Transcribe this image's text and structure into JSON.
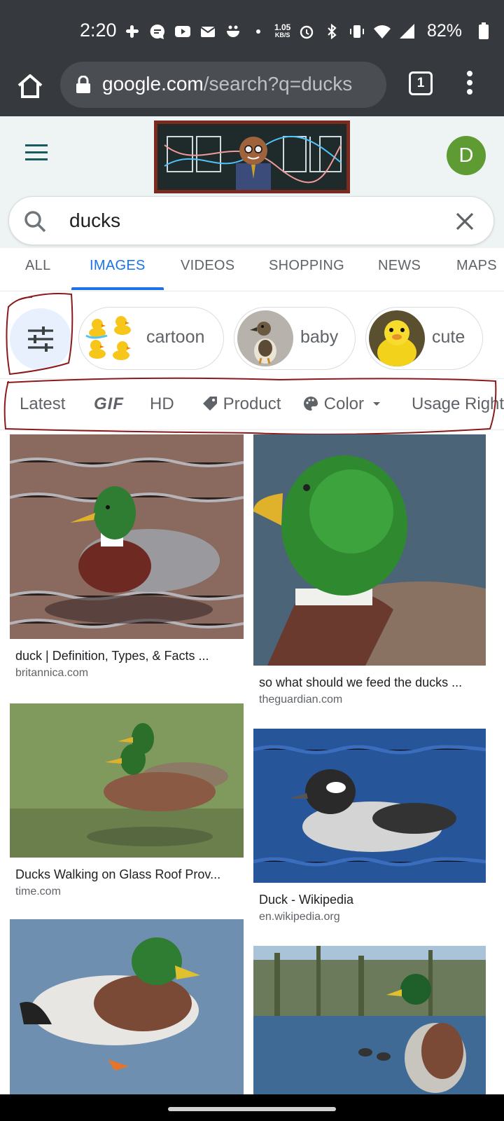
{
  "status_bar": {
    "time": "2:20",
    "net_speed": "1.05",
    "net_unit": "KB/S",
    "battery": "82%"
  },
  "browser": {
    "url_domain": "google.com",
    "url_path": "/search?q=ducks",
    "tab_count": "1"
  },
  "header": {
    "avatar_letter": "D"
  },
  "search": {
    "query": "ducks"
  },
  "tabs": [
    {
      "label": "ALL"
    },
    {
      "label": "IMAGES"
    },
    {
      "label": "VIDEOS"
    },
    {
      "label": "SHOPPING"
    },
    {
      "label": "NEWS"
    },
    {
      "label": "MAPS"
    }
  ],
  "chips": [
    {
      "label": "cartoon"
    },
    {
      "label": "baby"
    },
    {
      "label": "cute"
    }
  ],
  "tools": {
    "latest": "Latest",
    "gif": "GIF",
    "hd": "HD",
    "product": "Product",
    "color": "Color",
    "usage": "Usage Rights"
  },
  "results": [
    {
      "title": "duck | Definition, Types, & Facts ...",
      "source": "britannica.com"
    },
    {
      "title": "so what should we feed the ducks ...",
      "source": "theguardian.com"
    },
    {
      "title": "Ducks Walking on Glass Roof Prov...",
      "source": "time.com"
    },
    {
      "title": "Duck - Wikipedia",
      "source": "en.wikipedia.org"
    }
  ],
  "colors": {
    "accent": "#1a73e8",
    "chrome_bg": "#36393d",
    "avatar": "#5e9b32",
    "annotation": "#8b1a1a"
  }
}
